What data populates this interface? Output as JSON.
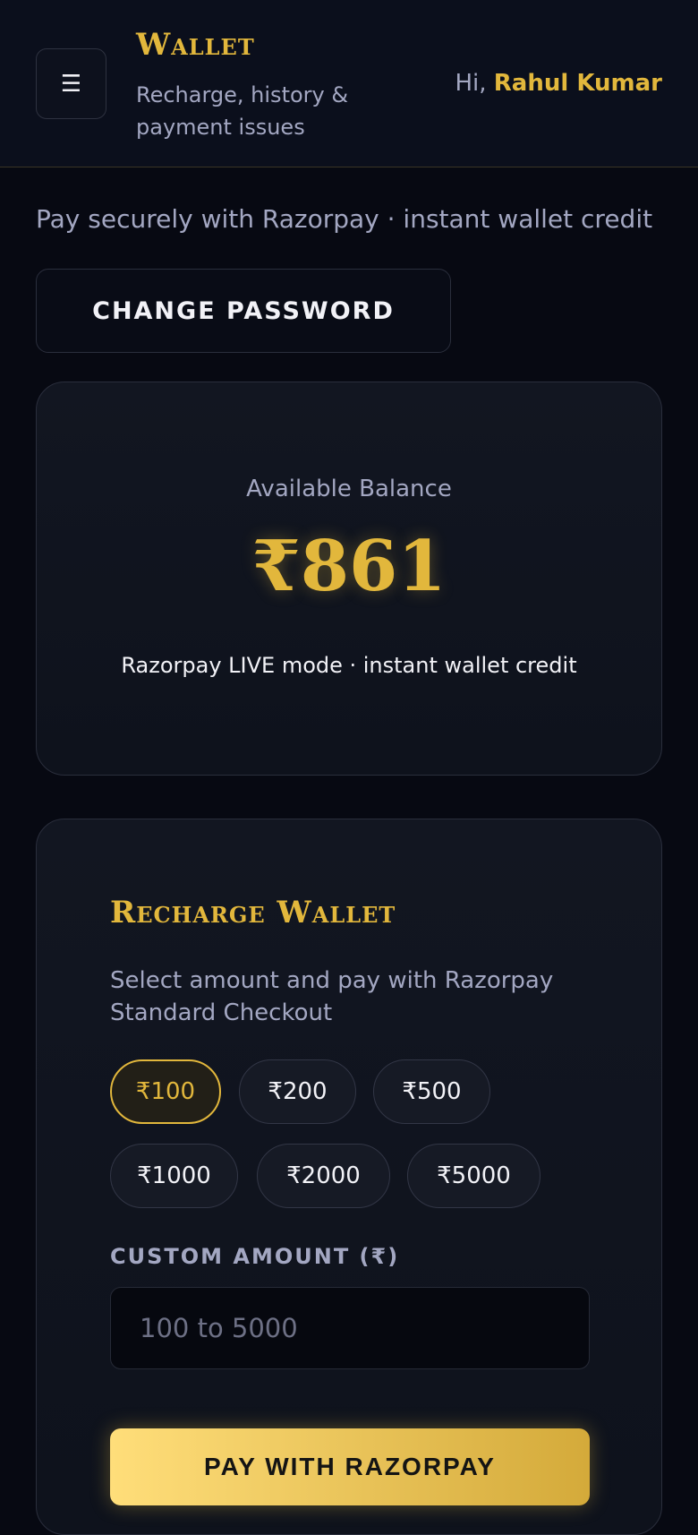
{
  "header": {
    "menu_icon": "☰",
    "title": "Wallet",
    "subtitle": "Recharge, history & payment issues",
    "greeting_prefix": "Hi, ",
    "user_name": "Rahul Kumar"
  },
  "tagline": "Pay securely with Razorpay · instant wallet credit",
  "change_password_label": "CHANGE PASSWORD",
  "balance": {
    "label": "Available Balance",
    "amount": "₹861",
    "note": "Razorpay LIVE mode · instant wallet credit"
  },
  "recharge": {
    "title": "Recharge Wallet",
    "subtitle": "Select amount and pay with Razorpay Standard Checkout",
    "amounts": [
      "₹100",
      "₹200",
      "₹500",
      "₹1000",
      "₹2000",
      "₹5000"
    ],
    "selected_amount": "₹100",
    "custom_label": "CUSTOM AMOUNT (₹)",
    "custom_placeholder": "100 to 5000",
    "custom_value": "",
    "pay_label": "PAY WITH RAZORPAY"
  },
  "colors": {
    "accent": "#e2b73c",
    "background": "#070912",
    "muted_text": "#a3a7c2"
  }
}
